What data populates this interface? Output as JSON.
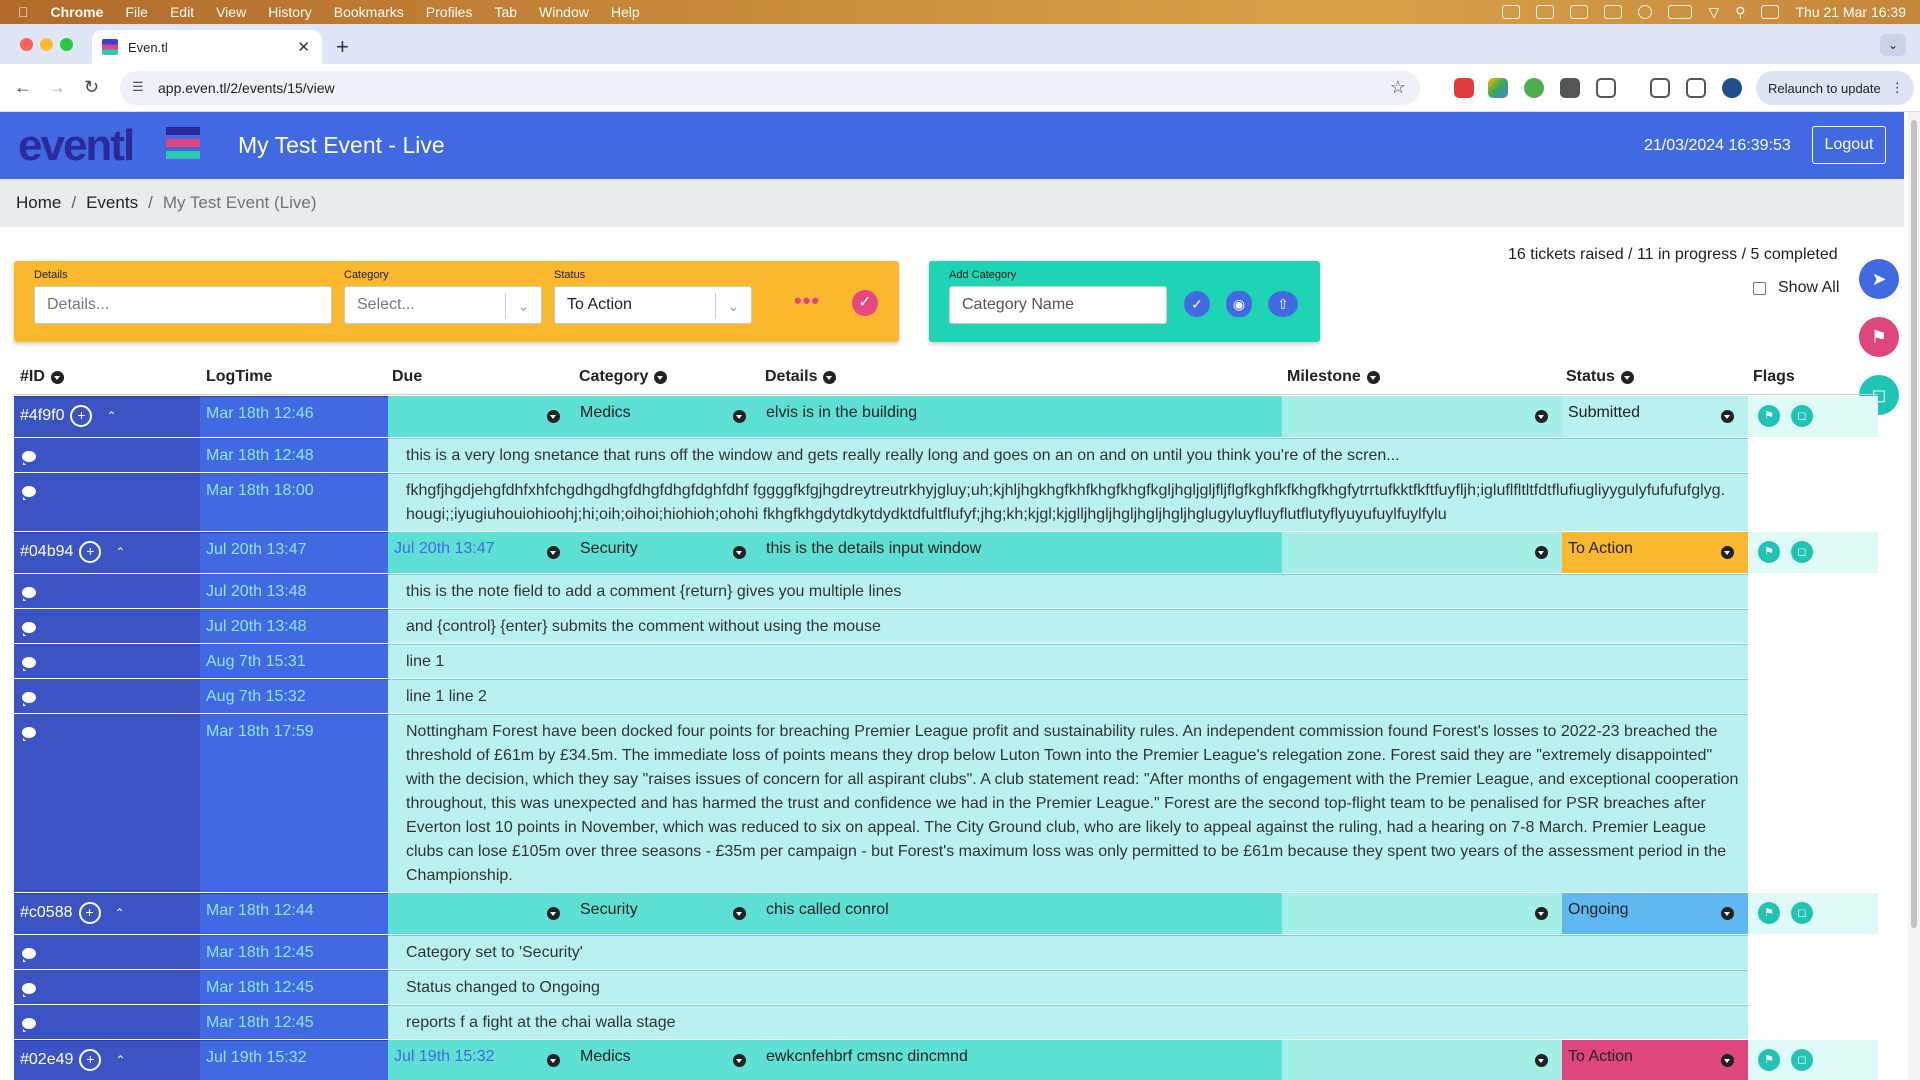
{
  "menubar": {
    "apple": "",
    "app": "Chrome",
    "items": [
      "File",
      "Edit",
      "View",
      "History",
      "Bookmarks",
      "Profiles",
      "Tab",
      "Window",
      "Help"
    ],
    "datetime": "Thu 21 Mar  16:39"
  },
  "browser": {
    "tab_title": "Even.tl",
    "url": "app.even.tl/2/events/15/view",
    "relaunch": "Relaunch to update"
  },
  "header": {
    "logo": "eventl",
    "title": "My Test Event - Live",
    "clock": "21/03/2024 16:39:53",
    "logout": "Logout",
    "brand_colors": {
      "primary": "#4169e1",
      "pink": "#e0467e",
      "teal": "#2cc7b3"
    }
  },
  "breadcrumb": [
    "Home",
    "Events",
    "My Test Event (Live)"
  ],
  "filters": {
    "details_label": "Details",
    "details_placeholder": "Details...",
    "category_label": "Category",
    "category_value": "Select...",
    "status_label": "Status",
    "status_value": "To Action",
    "more": "•••"
  },
  "add_category": {
    "label": "Add Category",
    "placeholder": "Category Name"
  },
  "stats": "16 tickets raised / 11 in progress / 5 completed",
  "show_all": "Show All",
  "columns": [
    "#ID",
    "LogTime",
    "Due",
    "Category",
    "Details",
    "Milestone",
    "Status",
    "Flags"
  ],
  "tickets": [
    {
      "id": "#4f9f0",
      "log": "Mar 18th 12:46",
      "due": "",
      "category": "Medics",
      "details": "elvis is in the building",
      "milestone": "",
      "status": "Submitted",
      "status_color": "#b8f1ef",
      "notes": [
        {
          "time": "Mar 18th 12:48",
          "text": "this is a very long snetance that runs off the window and gets really really long and goes on an on and on until you think you're of the scren..."
        },
        {
          "time": "Mar 18th 18:00",
          "text": "fkhgfjhgdjehgfdhfxhfchgdhgdhgfdhgfdhgfdghfdhf fggggfkfgjhgdreytreutrkhyjgluy;uh;kjhljhgkhgfkhfkhgfkhgfkgljhgljgljfljflgfkghfkfkhgfkhgfytrrtufkktfkftfuyfljh;igluflfltltfdtflufiugliyygulyfufufufglyg.hougi;;iyugiuhouiohioohj;hi;oih;oihoi;hiohioh;ohohi fkhgfkhgdytdkytdydktdfultflufyf;jhg;kh;kjgl;kjglljhgljhgljhgljhgljhglugyluyfluyflutflutyflyuyufuylfuylfylu"
        }
      ]
    },
    {
      "id": "#04b94",
      "log": "Jul 20th 13:47",
      "due": "Jul 20th 13:47",
      "category": "Security",
      "details": "this is the details input window",
      "milestone": "",
      "status": "To Action",
      "status_color": "#f9b82e",
      "notes": [
        {
          "time": "Jul 20th 13:48",
          "text": "this is the note field to add a comment {return} gives you multiple lines"
        },
        {
          "time": "Jul 20th 13:48",
          "text": "and {control} {enter} submits the comment without using the mouse"
        },
        {
          "time": "Aug 7th 15:31",
          "text": "line 1"
        },
        {
          "time": "Aug 7th 15:32",
          "text": "line 1 line 2"
        },
        {
          "time": "Mar 18th 17:59",
          "text": "Nottingham Forest have been docked four points for breaching Premier League profit and sustainability rules. An independent commission found Forest's losses to 2022-23 breached the threshold of £61m by £34.5m. The immediate loss of points means they drop below Luton Town into the Premier League's relegation zone. Forest said they are \"extremely disappointed\" with the decision, which they say \"raises issues of concern for all aspirant clubs\". A club statement read: \"After months of engagement with the Premier League, and exceptional cooperation throughout, this was unexpected and has harmed the trust and confidence we had in the Premier League.\" Forest are the second top-flight team to be penalised for PSR breaches after Everton lost 10 points in November, which was reduced to six on appeal. The City Ground club, who are likely to appeal against the ruling, had a hearing on 7-8 March. Premier League clubs can lose £105m over three seasons - £35m per campaign - but Forest's maximum loss was only permitted to be £61m because they spent two years of the assessment period in the Championship."
        }
      ]
    },
    {
      "id": "#c0588",
      "log": "Mar 18th 12:44",
      "due": "",
      "category": "Security",
      "details": "chis called conrol",
      "milestone": "",
      "status": "Ongoing",
      "status_color": "#5fb8f0",
      "notes": [
        {
          "time": "Mar 18th 12:45",
          "text": "Category set to 'Security'"
        },
        {
          "time": "Mar 18th 12:45",
          "text": "Status changed to Ongoing"
        },
        {
          "time": "Mar 18th 12:45",
          "text": "reports f a fight at the chai walla stage"
        }
      ]
    },
    {
      "id": "#02e49",
      "log": "Jul 19th 15:32",
      "due": "Jul 19th 15:32",
      "category": "Medics",
      "details": "ewkcnfehbrf cmsnc dincmnd",
      "milestone": "",
      "status": "To Action",
      "status_color": "#e0467e",
      "notes": []
    }
  ]
}
